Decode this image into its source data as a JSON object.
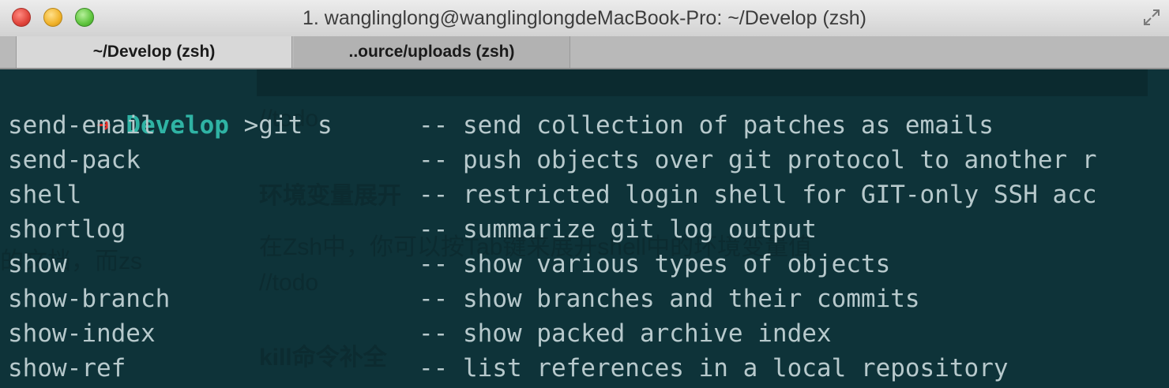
{
  "window": {
    "title": "1. wanglinglong@wanglinglongdeMacBook-Pro: ~/Develop (zsh)"
  },
  "tabs": [
    {
      "label": "~/Develop (zsh)",
      "active": true
    },
    {
      "label": "..ource/uploads (zsh)",
      "active": false
    }
  ],
  "background_text": {
    "todo_1": "//todo",
    "heading_1": "环境变量展开",
    "para_1": "在Zsh中，你可以按Tab键来展开shell中的环境变量值",
    "todo_2": "//todo",
    "heading_2": "kill命令补全",
    "side_1": "的文档，而zs"
  },
  "terminal": {
    "prompt": {
      "arrow": "➜",
      "dir": "Develop",
      "input": " >git s"
    },
    "completions": [
      {
        "cmd": "send-email",
        "desc": "-- send collection of patches as emails"
      },
      {
        "cmd": "send-pack",
        "desc": "-- push objects over git protocol to another r"
      },
      {
        "cmd": "shell",
        "desc": "-- restricted login shell for GIT-only SSH acc"
      },
      {
        "cmd": "shortlog",
        "desc": "-- summarize git log output"
      },
      {
        "cmd": "show",
        "desc": "-- show various types of objects"
      },
      {
        "cmd": "show-branch",
        "desc": "-- show branches and their commits"
      },
      {
        "cmd": "show-index",
        "desc": "-- show packed archive index"
      },
      {
        "cmd": "show-ref",
        "desc": "-- list references in a local repository"
      }
    ]
  },
  "colors": {
    "terminal_bg": "#0e3339",
    "prompt_arrow": "#e5302a",
    "prompt_dir": "#2fb3a4",
    "text": "#b7c9cc"
  }
}
